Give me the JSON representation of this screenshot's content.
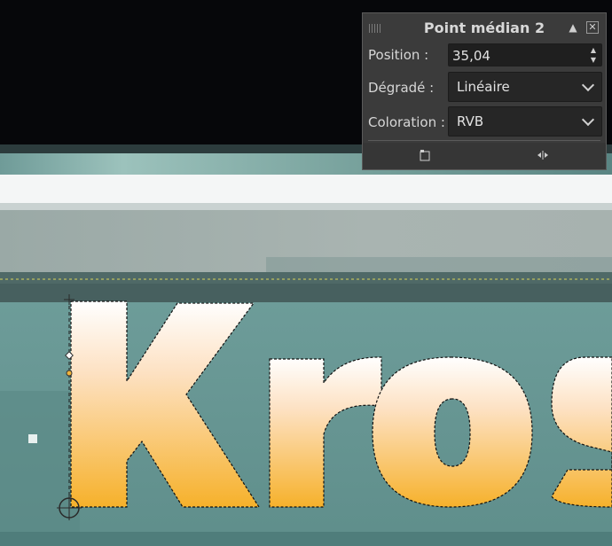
{
  "panel": {
    "title": "Point médian 2",
    "position_label": "Position :",
    "position_value": "35,04",
    "gradient_label": "Dégradé :",
    "gradient_value": "Linéaire",
    "coloring_label": "Coloration :",
    "coloring_value": "RVB",
    "icons": {
      "collapse": "eject-icon",
      "close": "close-icon",
      "grip": "grip-icon",
      "left_footer": "new-tab-icon",
      "right_footer": "center-split-icon"
    }
  },
  "canvas": {
    "banner_text": "Kros",
    "colors": {
      "background_black": "#06070a",
      "teal": "#6a9e9b",
      "gray_band": "#9eaeab",
      "orange": "#f6b12b",
      "peach": "#fde1c2"
    }
  }
}
